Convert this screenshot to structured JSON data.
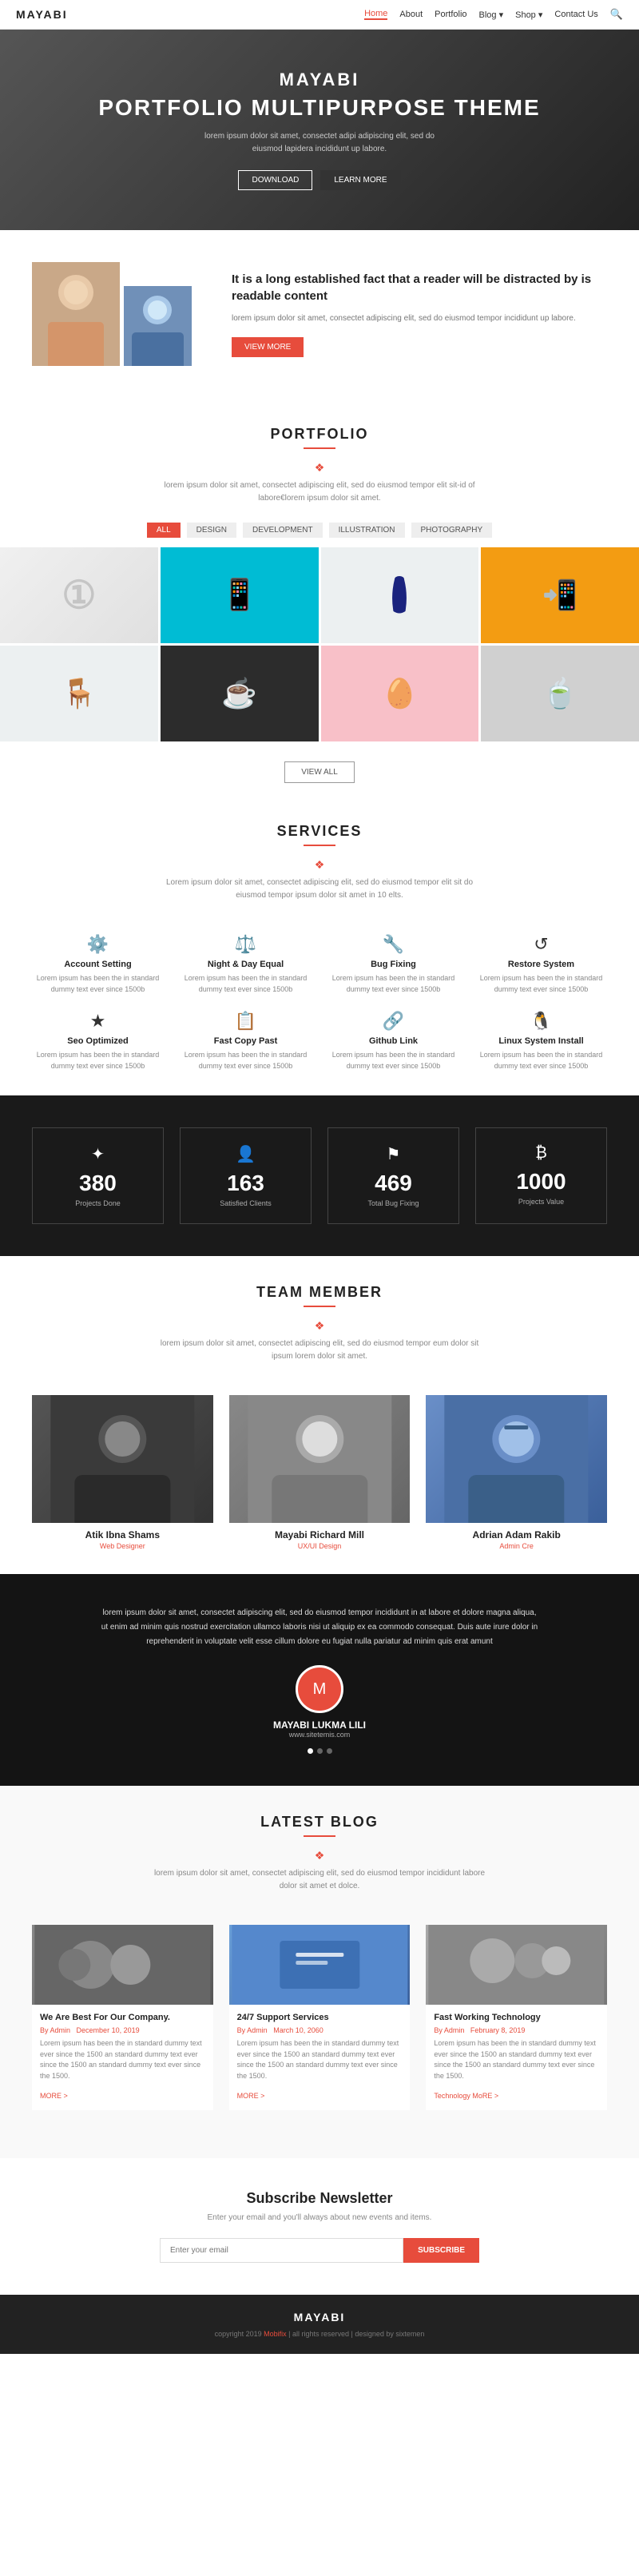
{
  "brand": "MAYABI",
  "navbar": {
    "links": [
      {
        "label": "Home",
        "active": true
      },
      {
        "label": "About"
      },
      {
        "label": "Portfolio"
      },
      {
        "label": "Blog",
        "dropdown": true
      },
      {
        "label": "Shop",
        "dropdown": true
      },
      {
        "label": "Contact Us"
      }
    ]
  },
  "hero": {
    "title": "MAYABI",
    "subtitle": "PORTFOLIO MULTIPURPOSE THEME",
    "description": "lorem ipsum dolor sit amet, consectet adipi adipiscing elit, sed do eiusmod lapidera incididunt up labore.",
    "btn_download": "DOWNLOAD",
    "btn_learn": "LEARN MORE"
  },
  "about": {
    "heading": "It is a long established fact that a reader will be distracted by is readable content",
    "description": "lorem ipsum dolor sit amet, consectet adipiscing elit, sed do eiusmod tempor incididunt up labore.",
    "btn_label": "VIEW MORE"
  },
  "portfolio": {
    "title": "PORTFOLIO",
    "description": "lorem ipsum dolor sit amet, consectet adipiscing elit, sed do eiusmod\ntempor elit sit-id of labore€lorem ipsum dolor sit amet.",
    "filter_all": "ALL",
    "filters": [
      "DESIGN",
      "DEVELOPMENT",
      "ILLUSTRATION",
      "PHOTOGRAPHY"
    ],
    "view_all": "VIEW ALL"
  },
  "services": {
    "title": "SERVICES",
    "description": "Lorem ipsum dolor sit amet, consectet adipiscing elit, sed do eiusmod\ntempor elit sit do eiusmod tempor ipsum dolor sit amet in 10 elts.",
    "items": [
      {
        "icon": "⚙",
        "name": "Account Setting",
        "desc": "Lorem ipsum has been the in standard dummy text ever since 1500b"
      },
      {
        "icon": "⚖",
        "name": "Night & Day Equal",
        "desc": "Lorem ipsum has been the in standard dummy text ever since 1500b"
      },
      {
        "icon": "🔧",
        "name": "Bug Fixing",
        "desc": "Lorem ipsum has been the in standard dummy text ever since 1500b"
      },
      {
        "icon": "↺",
        "name": "Restore System",
        "desc": "Lorem ipsum has been the in standard dummy text ever since 1500b"
      },
      {
        "icon": "★",
        "name": "Seo Optimized",
        "desc": "Lorem ipsum has been the in standard dummy text ever since 1500b"
      },
      {
        "icon": "📋",
        "name": "Fast Copy Past",
        "desc": "Lorem ipsum has been the in standard dummy text ever since 1500b"
      },
      {
        "icon": "🔗",
        "name": "Github Link",
        "desc": "Lorem ipsum has been the in standard dummy text ever since 1500b"
      },
      {
        "icon": "🐧",
        "name": "Linux System Install",
        "desc": "Lorem ipsum has been the in standard dummy text ever since 1500b"
      }
    ]
  },
  "stats": [
    {
      "icon": "✦",
      "num": "380",
      "label": "Projects Done"
    },
    {
      "icon": "👥",
      "num": "163",
      "label": "Satisfied Clients"
    },
    {
      "icon": "⚑",
      "num": "469",
      "label": "Total Bug Fixing"
    },
    {
      "icon": "₿",
      "num": "1000",
      "label": "Projects Value"
    }
  ],
  "team": {
    "title": "TEAM MEMBER",
    "description": "lorem ipsum dolor sit amet, consectet adipiscing elit, sed do eiusmod\ntempor eum dolor sit ipsum lorem dolor sit amet.",
    "members": [
      {
        "name": "Atik Ibna Shams",
        "role": "Web Designer"
      },
      {
        "name": "Mayabi Richard Mill",
        "role": "UX/UI Design"
      },
      {
        "name": "Adrian Adam Rakib",
        "role": "Admin Cre"
      }
    ]
  },
  "testimonial": {
    "text": "lorem ipsum dolor sit amet, consectet adipiscing elit, sed do eiusmod tempor incididunt in at labore et dolore magna aliqua, ut enim ad minim quis nostrud exercitation ullamco laboris nisi ut aliquip ex ea commodo consequat. Duis aute irure dolor in reprehenderit in voluptate velit esse cillum dolore eu fugiat nulla pariatur ad minim quis erat amunt",
    "avatar_icon": "M",
    "name": "MAYABI LUKMA LILI",
    "site": "www.sitetemis.com"
  },
  "blog": {
    "title": "LATEST BLOG",
    "description": "lorem ipsum dolor sit amet, consectet adipiscing elit, sed do eiusmod\ntempor incididunt labore dolor sit amet et dolce.",
    "posts": [
      {
        "title": "We Are Best For Our Company.",
        "meta_author": "By Admin",
        "meta_date": "December 10, 2019",
        "excerpt": "Lorem ipsum has been the in standard dummy text ever since the 1500 an standard dummy text ever since the 1500 an standard dummy text ever since the 1500.",
        "more": "MORE >"
      },
      {
        "title": "24/7 Support Services",
        "meta_author": "By Admin",
        "meta_date": "March 10, 2060",
        "excerpt": "Lorem ipsum has been the in standard dummy text ever since the 1500 an standard dummy text ever since the 1500 an standard dummy text ever since the 1500.",
        "more": "MORE >"
      },
      {
        "title": "Fast Working Technology",
        "meta_author": "By Admin",
        "meta_date": "February 8, 2019",
        "excerpt": "Lorem ipsum has been the in standard dummy text ever since the 1500 an standard dummy text ever since the 1500 an standard dummy text ever since the 1500.",
        "more": "Technology MoRE >"
      }
    ]
  },
  "newsletter": {
    "title": "Subscribe Newsletter",
    "description": "Enter your email and you'll always about new events and items.",
    "input_placeholder": "Enter your email",
    "btn_label": "SUBSCRIBE"
  },
  "footer": {
    "brand": "MAYABI",
    "copy": "copyright 2019",
    "company": "Mobifix",
    "rights": "all rights reserved | designed by sixtemen"
  }
}
